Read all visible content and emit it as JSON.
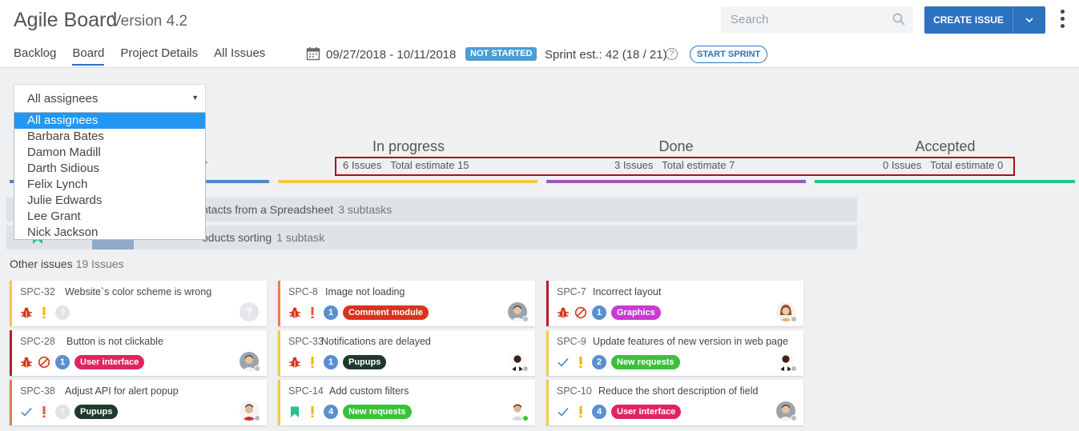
{
  "app": {
    "title": "Agile Board",
    "version": "Version 4.2"
  },
  "search": {
    "placeholder": "Search"
  },
  "actions": {
    "create_issue": "CREATE ISSUE"
  },
  "nav": [
    "Backlog",
    "Board",
    "Project Details",
    "All Issues"
  ],
  "sprint": {
    "dates": "09/27/2018 - 10/11/2018",
    "status": "NOT STARTED",
    "estimate": "Sprint est.: 42 (18 / 21)",
    "start_label": "START SPRINT"
  },
  "filter": {
    "selected": "All assignees",
    "options": [
      "All assignees",
      "Barbara Bates",
      "Damon Madill",
      "Darth Sidious",
      "Felix Lynch",
      "Julie Edwards",
      "Lee Grant",
      "Nick Jackson"
    ]
  },
  "columns": [
    {
      "title": "In progress",
      "issues": "6 Issues",
      "estimate": "Total estimate 15",
      "color": "#f2c94c"
    },
    {
      "title": "Done",
      "issues": "3 Issues",
      "estimate": "Total estimate 7",
      "color": "#9b59b6"
    },
    {
      "title": "Accepted",
      "issues": "0 Issues",
      "estimate": "Total estimate 0",
      "color": "#27c28a"
    }
  ],
  "todo_fragment": "7",
  "todo_line_color": "#4a8ac6",
  "swimlanes": [
    {
      "title": "ntacts from a Spreadsheet",
      "subtasks": "3 subtasks"
    },
    {
      "title": "oducts sorting",
      "subtasks": "1 subtask"
    }
  ],
  "other_issues": {
    "label": "Other issues",
    "count": "19 Issues"
  },
  "cards": [
    {
      "key": "SPC-32",
      "summary": "Website`s color scheme is wrong",
      "color": "#f2c94c",
      "icons": [
        "bug",
        "priority-high"
      ],
      "num": "?",
      "tag": "",
      "tag_color": "",
      "avatar": "placeholder"
    },
    {
      "key": "SPC-8",
      "summary": "Image not loading",
      "color": "#e67e50",
      "icons": [
        "bug",
        "priority-critical"
      ],
      "num": "1",
      "tag": "Comment module",
      "tag_color": "#d9331d",
      "avatar": "man"
    },
    {
      "key": "SPC-7",
      "summary": "Incorrect layout",
      "color": "#b22030",
      "icons": [
        "bug",
        "blocked"
      ],
      "num": "1",
      "tag": "Graphics",
      "tag_color": "#c73bd1",
      "avatar": "woman"
    },
    {
      "key": "SPC-28",
      "summary": "Button is not clickable",
      "color": "#b22030",
      "icons": [
        "bug",
        "blocked"
      ],
      "num": "1",
      "tag": "User interface",
      "tag_color": "#e0245e",
      "avatar": "man"
    },
    {
      "key": "SPC-33",
      "summary": "Notifications are delayed",
      "color": "#f2c94c",
      "icons": [
        "bug",
        "priority-high"
      ],
      "num": "1",
      "tag": "Pupups",
      "tag_color": "#1f3a2c",
      "avatar": "man-dark"
    },
    {
      "key": "SPC-9",
      "summary": "Update features of new version in web page",
      "color": "#f2c94c",
      "icons": [
        "check",
        "priority-high"
      ],
      "num": "2",
      "tag": "New requests",
      "tag_color": "#3ac13a",
      "avatar": "man-dark"
    },
    {
      "key": "SPC-38",
      "summary": "Adjust API for alert popup",
      "color": "#e67e50",
      "icons": [
        "check",
        "priority-critical"
      ],
      "num": "?",
      "tag": "Pupups",
      "tag_color": "#1f3a2c",
      "avatar": "man-red"
    },
    {
      "key": "SPC-14",
      "summary": "Add custom filters",
      "color": "#f2c94c",
      "icons": [
        "story",
        "priority-high"
      ],
      "num": "4",
      "tag": "New requests",
      "tag_color": "#3ac13a",
      "avatar": "man-online"
    },
    {
      "key": "SPC-10",
      "summary": "Reduce the short description of field",
      "color": "#f2c94c",
      "icons": [
        "check",
        "priority-high"
      ],
      "num": "4",
      "tag": "User interface",
      "tag_color": "#e0245e",
      "avatar": "man"
    }
  ]
}
